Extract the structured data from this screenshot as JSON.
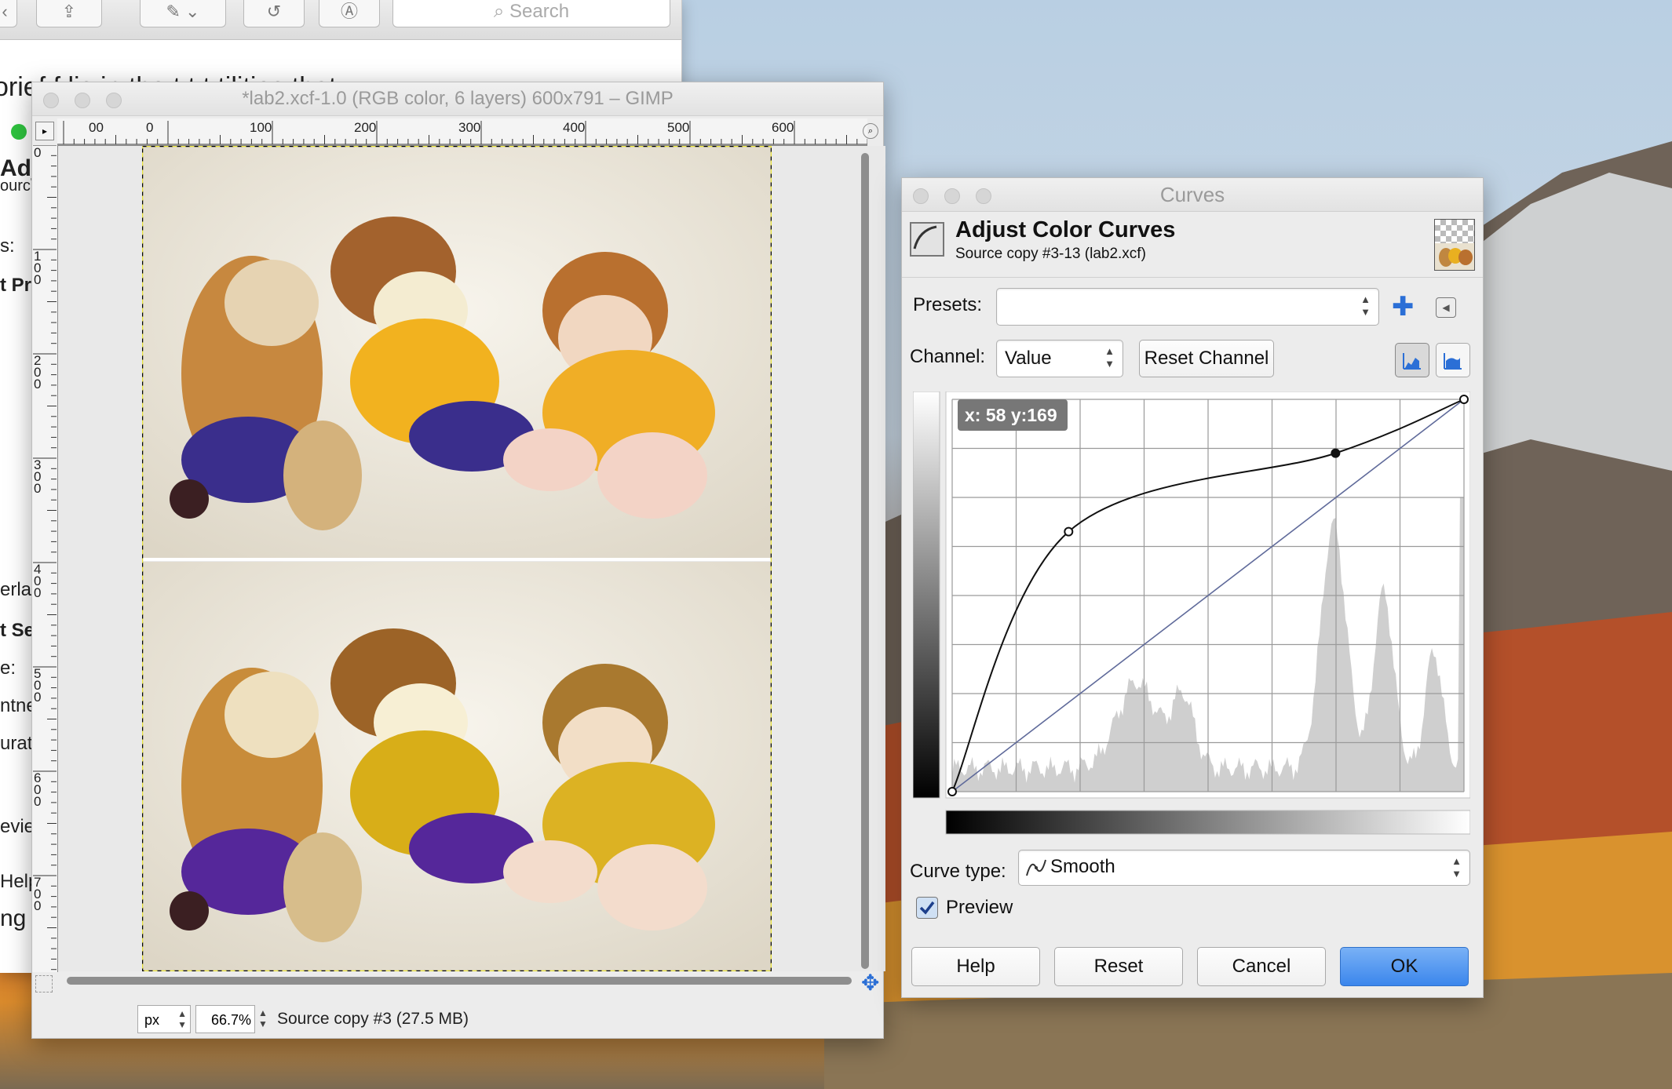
{
  "editor": {
    "search_placeholder": "Search",
    "body_text": "orief   f          lis in the t   t t      tilities  that",
    "fragments": [
      "Adju",
      "ourc",
      "s:",
      "t Pri",
      "erlap",
      "t Se",
      "e:",
      "ntne",
      "urati",
      "evie",
      "Help",
      "ng"
    ]
  },
  "gimp": {
    "title": "*lab2.xcf-1.0 (RGB color, 6 layers) 600x791 – GIMP",
    "ruler_top_labels": [
      "00",
      "0",
      "100",
      "200",
      "300",
      "400",
      "500",
      "600"
    ],
    "ruler_left_labels": [
      "0",
      "1 0 0",
      "2 0 0",
      "3 0 0",
      "4 0 0",
      "5 0 0",
      "6 0 0",
      "7 0 0"
    ],
    "unit": "px",
    "zoom": "66.7%",
    "status": "Source copy #3 (27.5 MB)"
  },
  "curves": {
    "window_title": "Curves",
    "title": "Adjust Color Curves",
    "subtitle": "Source copy #3-13 (lab2.xcf)",
    "presets_label": "Presets:",
    "presets_value": "",
    "channel_label": "Channel:",
    "channel_value": "Value",
    "reset_channel": "Reset Channel",
    "coord_readout": "x: 58 y:169",
    "curve_type_label": "Curve type:",
    "curve_type_value": "Smooth",
    "preview_label": "Preview",
    "preview_checked": true,
    "buttons": {
      "help": "Help",
      "reset": "Reset",
      "cancel": "Cancel",
      "ok": "OK"
    },
    "control_points": [
      [
        0,
        0
      ],
      [
        58,
        169
      ],
      [
        191,
        220
      ],
      [
        255,
        255
      ]
    ],
    "accent": "#3b86ec"
  }
}
